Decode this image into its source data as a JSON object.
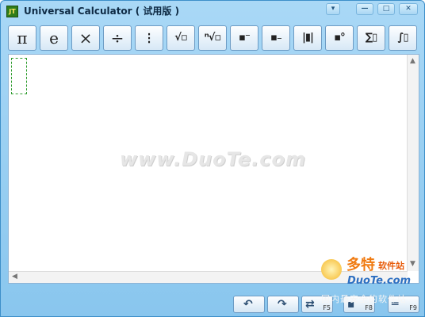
{
  "window": {
    "title": "Universal Calculator ( 试用版 )",
    "app_icon_text": "JT",
    "controls": {
      "menu": "▾",
      "minimize": "—",
      "maximize": "□",
      "close": "✕"
    }
  },
  "toolbar": {
    "buttons": [
      {
        "name": "pi",
        "symbol": "π"
      },
      {
        "name": "euler-e",
        "symbol": "e"
      },
      {
        "name": "multiply",
        "symbol": "×"
      },
      {
        "name": "divide",
        "symbol": "÷"
      },
      {
        "name": "fraction",
        "symbol": "⁝"
      },
      {
        "name": "square-root",
        "symbol": "√▫"
      },
      {
        "name": "nth-root",
        "symbol": "ⁿ√▫"
      },
      {
        "name": "superscript",
        "symbol": "▪⁻"
      },
      {
        "name": "subscript",
        "symbol": "▪₋"
      },
      {
        "name": "absolute",
        "symbol": "|▮|"
      },
      {
        "name": "degree",
        "symbol": "▪°"
      },
      {
        "name": "sum",
        "symbol": "∑▯"
      },
      {
        "name": "integral",
        "symbol": "∫▯"
      }
    ]
  },
  "editor": {
    "watermark": "www.DuoTe.com",
    "scroll_up": "▲",
    "scroll_down": "▼",
    "scroll_left": "◀"
  },
  "bottom": {
    "undo": {
      "glyph": "↶",
      "key": ""
    },
    "redo": {
      "glyph": "↷",
      "key": ""
    },
    "swap": {
      "glyph": "⇄",
      "key": "F5"
    },
    "f8": {
      "glyph": "▪",
      "key": "F8"
    },
    "f9": {
      "glyph": "═",
      "key": "F9"
    }
  },
  "logo": {
    "cn_name": "多特",
    "cn_suffix": "软件站",
    "en_name": "DuoTe.com",
    "slogan": "国内最安全的软件站"
  }
}
